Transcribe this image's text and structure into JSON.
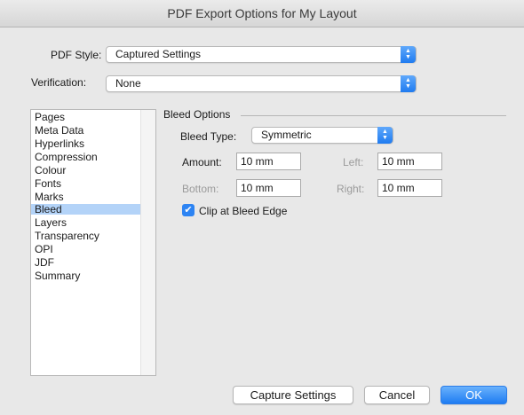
{
  "window": {
    "title": "PDF Export Options for My Layout"
  },
  "pdf_style": {
    "label": "PDF Style:",
    "value": "Captured Settings"
  },
  "verification": {
    "label": "Verification:",
    "value": "None"
  },
  "categories": {
    "items": [
      "Pages",
      "Meta Data",
      "Hyperlinks",
      "Compression",
      "Colour",
      "Fonts",
      "Marks",
      "Bleed",
      "Layers",
      "Transparency",
      "OPI",
      "JDF",
      "Summary"
    ],
    "selected": "Bleed"
  },
  "bleed_options": {
    "title": "Bleed Options",
    "bleed_type_label": "Bleed Type:",
    "bleed_type_value": "Symmetric",
    "amount_label": "Amount:",
    "amount_value": "10 mm",
    "left_label": "Left:",
    "left_value": "10 mm",
    "bottom_label": "Bottom:",
    "bottom_value": "10 mm",
    "right_label": "Right:",
    "right_value": "10 mm",
    "clip_label": "Clip at Bleed Edge",
    "clip_checked": true
  },
  "buttons": {
    "capture": "Capture Settings",
    "cancel": "Cancel",
    "ok": "OK"
  },
  "colors": {
    "accent": "#1e7cf2",
    "selection": "#b3d3f8"
  },
  "icons": {
    "stepper": "up-down-chevron-icon",
    "checkmark": "checkmark-icon"
  }
}
